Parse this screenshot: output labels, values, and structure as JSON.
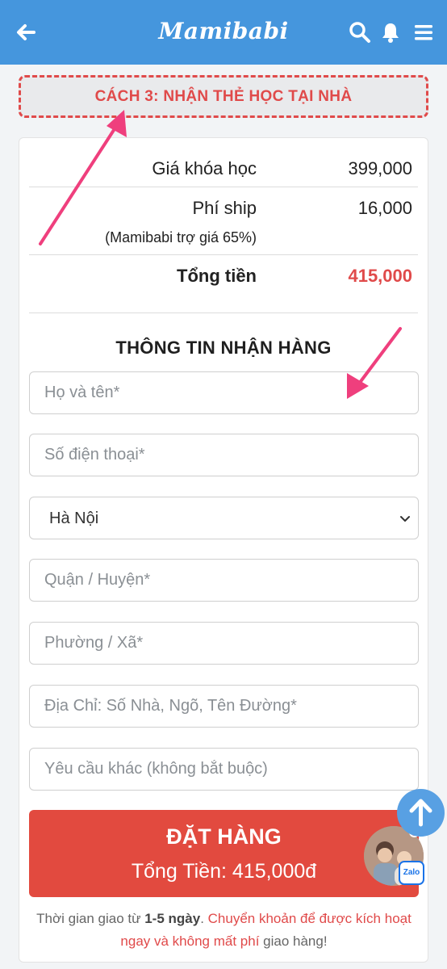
{
  "header": {
    "brand": "Mamibabi",
    "icons": [
      "back-arrow-icon",
      "search-icon",
      "bell-icon",
      "menu-icon"
    ],
    "color": "#4596dd"
  },
  "method": {
    "title": "CÁCH 3: NHẬN THẺ HỌC TẠI NHÀ",
    "color": "#e04a4a"
  },
  "summary": {
    "course_label": "Giá khóa học",
    "course_price": "399,000",
    "ship_label": "Phí ship",
    "ship_price": "16,000",
    "ship_note": "(Mamibabi trợ giá 65%)",
    "total_label": "Tổng tiền",
    "total_price": "415,000",
    "total_color": "#e04a4a"
  },
  "form": {
    "title": "THÔNG TIN NHẬN HÀNG",
    "name_placeholder": "Họ và tên*",
    "phone_placeholder": "Số điện thoại*",
    "city_selected": "Hà Nội",
    "district_placeholder": "Quận / Huyện*",
    "ward_placeholder": "Phường / Xã*",
    "address_placeholder": "Địa Chỉ: Số Nhà, Ngõ, Tên Đường*",
    "other_placeholder": "Yêu cầu khác (không bắt buộc)"
  },
  "order_button": {
    "label": "ĐẶT HÀNG",
    "total": "Tổng Tiền: 415,000đ",
    "color": "#e24a3f"
  },
  "note": {
    "text1": "Thời gian giao từ ",
    "days": "1-5 ngày",
    "text2": ". ",
    "red_text": "Chuyển khoản để được kích hoạt ngay và không mất phí",
    "text3": " giao hàng!"
  },
  "floating": {
    "zalo_label": "Zalo"
  }
}
